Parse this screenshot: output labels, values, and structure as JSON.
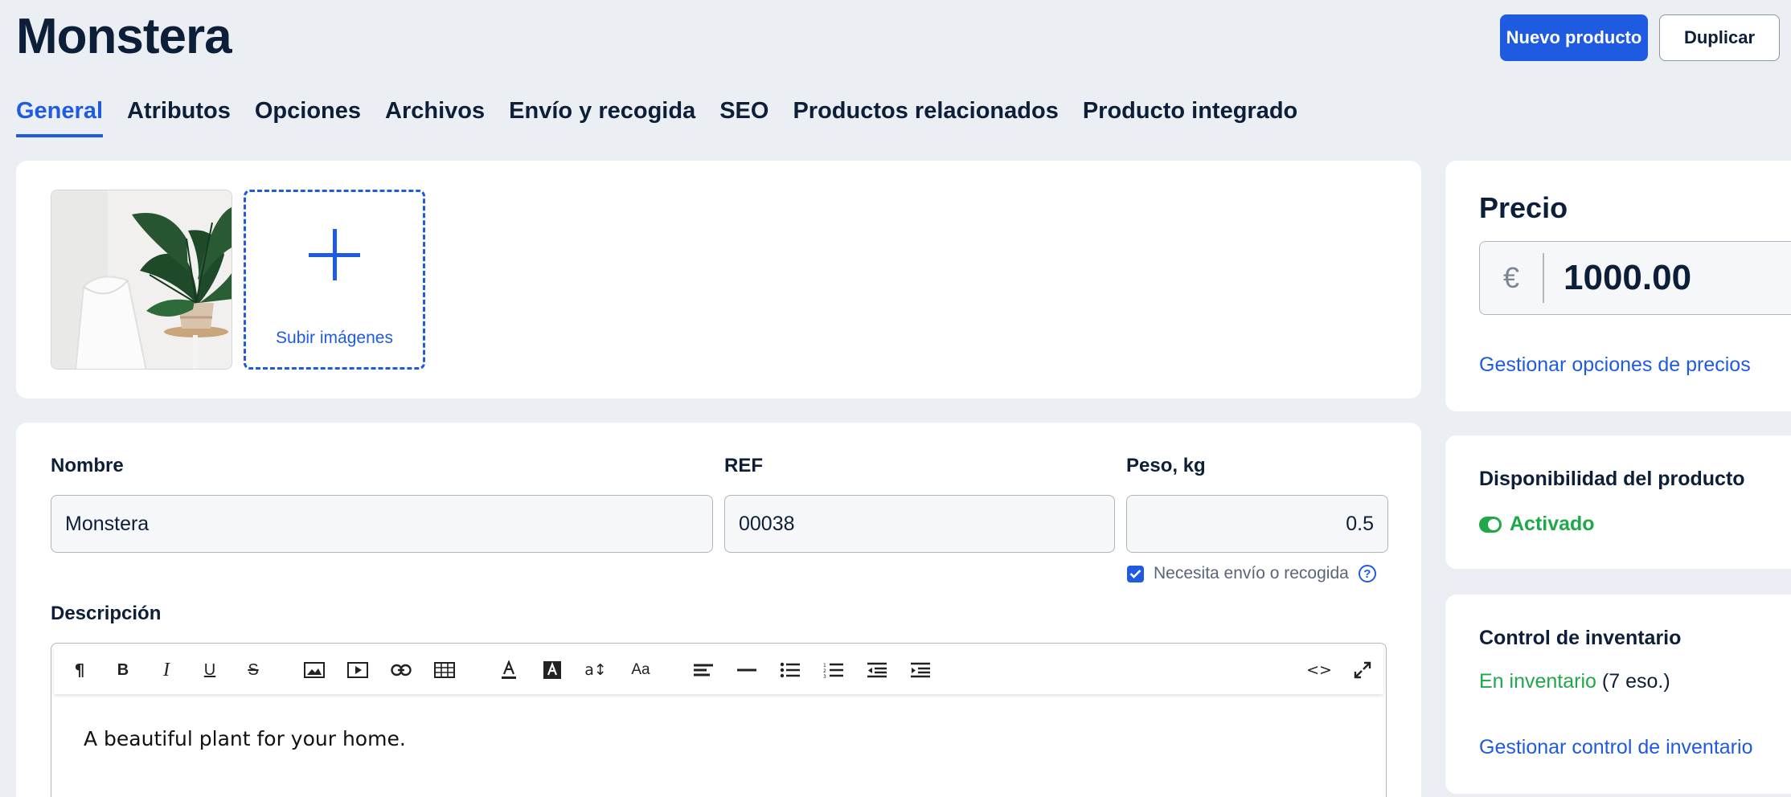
{
  "header": {
    "title": "Monstera",
    "new_product_label": "Nuevo producto",
    "duplicate_label": "Duplicar"
  },
  "tabs": [
    {
      "label": "General",
      "active": true
    },
    {
      "label": "Atributos"
    },
    {
      "label": "Opciones"
    },
    {
      "label": "Archivos"
    },
    {
      "label": "Envío y recogida"
    },
    {
      "label": "SEO"
    },
    {
      "label": "Productos relacionados"
    },
    {
      "label": "Producto integrado"
    }
  ],
  "images": {
    "upload_label": "Subir imágenes"
  },
  "form": {
    "name_label": "Nombre",
    "name_value": "Monstera",
    "ref_label": "REF",
    "ref_value": "00038",
    "weight_label": "Peso, kg",
    "weight_value": "0.5",
    "shipping_label": "Necesita envío o recogida",
    "shipping_checked": true,
    "help_icon": "?",
    "description_label": "Descripción",
    "description_text": "A beautiful plant for your home."
  },
  "editor_toolbar": {
    "paragraph": "¶",
    "bold": "B",
    "italic": "I",
    "underline": "U",
    "strike": "S",
    "font_size": "a↕",
    "case": "Aa",
    "code": "<>"
  },
  "price": {
    "title": "Precio",
    "currency": "€",
    "value": "1000.00",
    "manage_link": "Gestionar opciones de precios"
  },
  "availability": {
    "title": "Disponibilidad del producto",
    "status": "Activado"
  },
  "inventory": {
    "title": "Control de inventario",
    "status": "En inventario",
    "count": "(7 eso.)",
    "manage_link": "Gestionar control de inventario"
  },
  "colors": {
    "accent": "#1f5be0",
    "success": "#1fa84a",
    "background": "#ebeef2",
    "text": "#0d1f38"
  }
}
